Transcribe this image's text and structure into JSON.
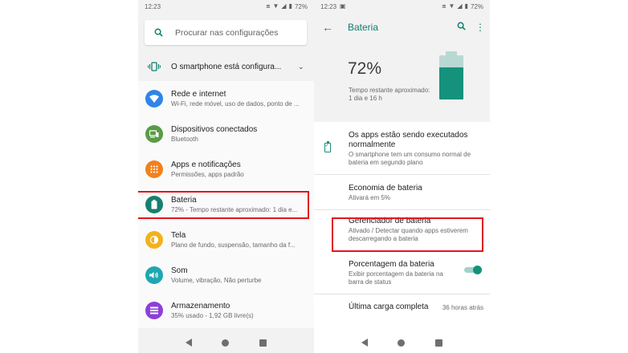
{
  "left": {
    "status": {
      "time": "12:23",
      "battery": "72%"
    },
    "search": {
      "placeholder": "Procurar nas configurações"
    },
    "suggestion": {
      "text": "O smartphone está configura..."
    },
    "items": [
      {
        "title": "Rede e internet",
        "subtitle": "Wi-Fi, rede móvel, uso de dados, ponto de ...",
        "icon": "wifi-icon",
        "color": "#2f84e8"
      },
      {
        "title": "Dispositivos conectados",
        "subtitle": "Bluetooth",
        "icon": "devices-icon",
        "color": "#5a9b45"
      },
      {
        "title": "Apps e notificações",
        "subtitle": "Permissões, apps padrão",
        "icon": "apps-icon",
        "color": "#f2801c"
      },
      {
        "title": "Bateria",
        "subtitle": "72% - Tempo restante aproximado: 1 dia e...",
        "icon": "battery-icon",
        "color": "#15806f"
      },
      {
        "title": "Tela",
        "subtitle": "Plano de fundo, suspensão, tamanho da f...",
        "icon": "display-icon",
        "color": "#f3b21a"
      },
      {
        "title": "Som",
        "subtitle": "Volume, vibração, Não perturbe",
        "icon": "sound-icon",
        "color": "#1ea7b1"
      },
      {
        "title": "Armazenamento",
        "subtitle": "35% usado - 1,92 GB livre(s)",
        "icon": "storage-icon",
        "color": "#8d3fd9"
      }
    ]
  },
  "right": {
    "status": {
      "time": "12:23",
      "battery": "72%"
    },
    "appbar": {
      "title": "Bateria"
    },
    "battery": {
      "percent": "72%",
      "level": 0.72,
      "remaining_label": "Tempo restante aproximado:",
      "remaining_value": "1 dia e 16 h"
    },
    "items": [
      {
        "title": "Os apps estão sendo executados normalmente",
        "subtitle": "O smartphone tem um consumo normal de bateria em segundo plano"
      },
      {
        "title": "Economia de bateria",
        "subtitle": "Ativará em 5%"
      },
      {
        "title": "Gerenciador de bateria",
        "subtitle": "Ativado / Detectar quando apps estiverem descarregando a bateria"
      },
      {
        "title": "Porcentagem da bateria",
        "subtitle": "Exibir porcentagem da bateria na barra de status",
        "toggle_on": true
      },
      {
        "title": "Última carga completa",
        "value": "36 horas atrás"
      }
    ]
  },
  "colors": {
    "accent": "#0f7d6f",
    "highlight": "#e0161f"
  }
}
